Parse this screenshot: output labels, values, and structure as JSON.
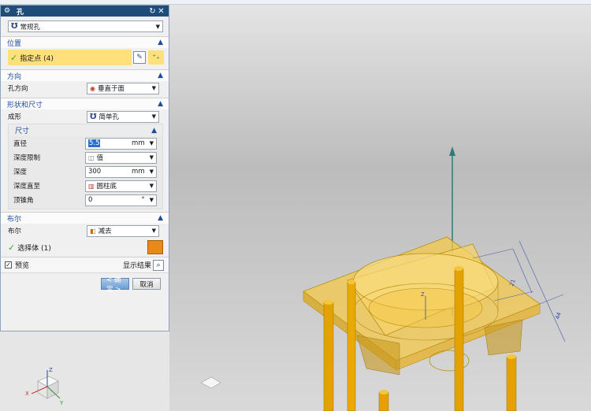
{
  "window": {
    "title": "孔"
  },
  "hole_type": {
    "value": "常规孔"
  },
  "sections": {
    "position": {
      "title": "位置",
      "specify_label": "指定点 (4)"
    },
    "direction": {
      "title": "方向",
      "hole_dir_label": "孔方向",
      "hole_dir_value": "垂直于面"
    },
    "shape": {
      "title": "形状和尺寸",
      "form_label": "成形",
      "form_value": "简单孔",
      "dims": {
        "title": "尺寸",
        "diameter_label": "直径",
        "diameter_value": "5.5",
        "diameter_unit": "mm",
        "depth_limit_label": "深度限制",
        "depth_limit_value": "值",
        "depth_label": "深度",
        "depth_value": "300",
        "depth_unit": "mm",
        "depth_to_label": "深度直至",
        "depth_to_value": "圆柱底",
        "tip_angle_label": "顶锥角",
        "tip_angle_value": "0",
        "tip_angle_unit": "°"
      }
    },
    "boolean": {
      "title": "布尔",
      "bool_label": "布尔",
      "bool_value": "减去",
      "select_body_label": "选择体 (1)"
    }
  },
  "preview": {
    "label": "预览",
    "checked": true,
    "show_result_label": "显示结果"
  },
  "buttons": {
    "ok": "< 确定 >",
    "cancel": "取消"
  },
  "viewport": {
    "dims": [
      "21",
      "44"
    ],
    "colors": {
      "part": "#f2c94c",
      "rod": "#e3a200",
      "vector": "#2f7a74"
    },
    "triad": [
      "X",
      "Y",
      "Z"
    ]
  }
}
